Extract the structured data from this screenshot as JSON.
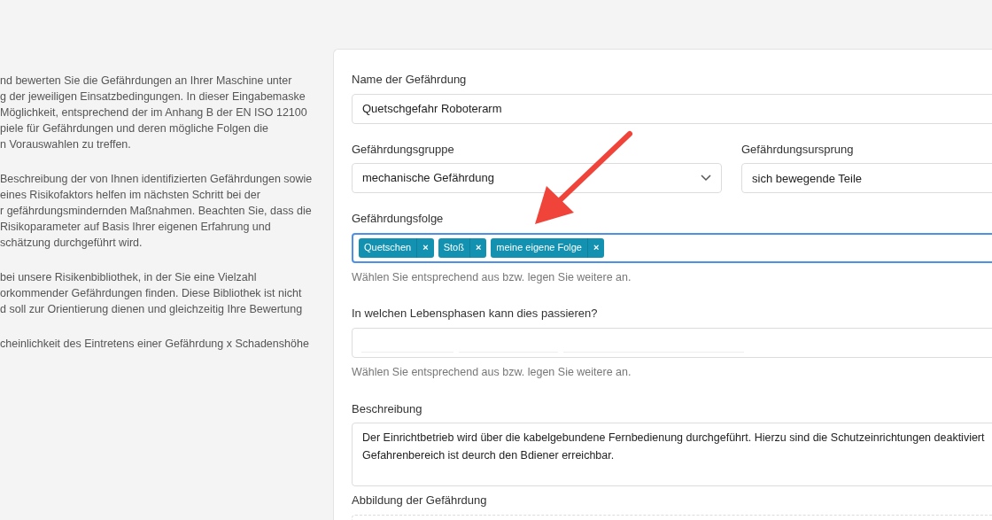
{
  "intro_paragraphs": [
    "nd bewerten Sie die Gefährdungen an Ihrer Maschine unter\ng der jeweiligen Einsatzbedingungen. In dieser Eingabemaske\nMöglichkeit, entsprechend der im Anhang B der EN ISO 12100\npiele für Gefährdungen und deren mögliche Folgen die\nn Vorauswahlen zu treffen.",
    "Beschreibung der von Ihnen identifizierten Gefährdungen sowie\neines Risikofaktors helfen im nächsten Schritt bei der\nr gefährdungsmindernden Maßnahmen. Beachten Sie, dass die\nRisikoparameter auf Basis Ihrer eigenen Erfahrung und\nschätzung durchgeführt wird.",
    "bei unsere Risikenbibliothek, in der Sie eine Vielzahl\norkommender Gefährdungen finden. Diese Bibliothek ist nicht\nd soll zur Orientierung dienen und gleichzeitig Ihre Bewertung",
    "cheinlichkeit des Eintretens einer Gefährdung x Schadenshöhe"
  ],
  "form": {
    "name": {
      "label": "Name der Gefährdung",
      "value": "Quetschgefahr Roboterarm"
    },
    "group": {
      "label": "Gefährdungsgruppe",
      "value": "mechanische Gefährdung"
    },
    "origin": {
      "label": "Gefährdungsursprung",
      "value": "sich bewegende Teile"
    },
    "consequences": {
      "label": "Gefährdungsfolge",
      "focused": true,
      "tags": [
        {
          "text": "Quetschen",
          "remove": "×"
        },
        {
          "text": "Stoß",
          "remove": "×"
        },
        {
          "text": "meine eigene Folge",
          "remove": "×"
        }
      ],
      "help": "Wählen Sie entsprechend aus bzw. legen Sie weitere an."
    },
    "phases": {
      "label": "In welchen Lebensphasen kann dies passieren?",
      "help": "Wählen Sie entsprechend aus bzw. legen Sie weitere an."
    },
    "description": {
      "label": "Beschreibung",
      "value": "Der Einrichtbetrieb wird über die kabelgebundene Fernbedienung durchgeführt. Hierzu sind die Schutzeinrichtungen deaktiviert\nGefahrenbereich ist deurch den Bdiener erreichbar."
    },
    "image": {
      "label": "Abbildung der Gefährdung"
    }
  }
}
